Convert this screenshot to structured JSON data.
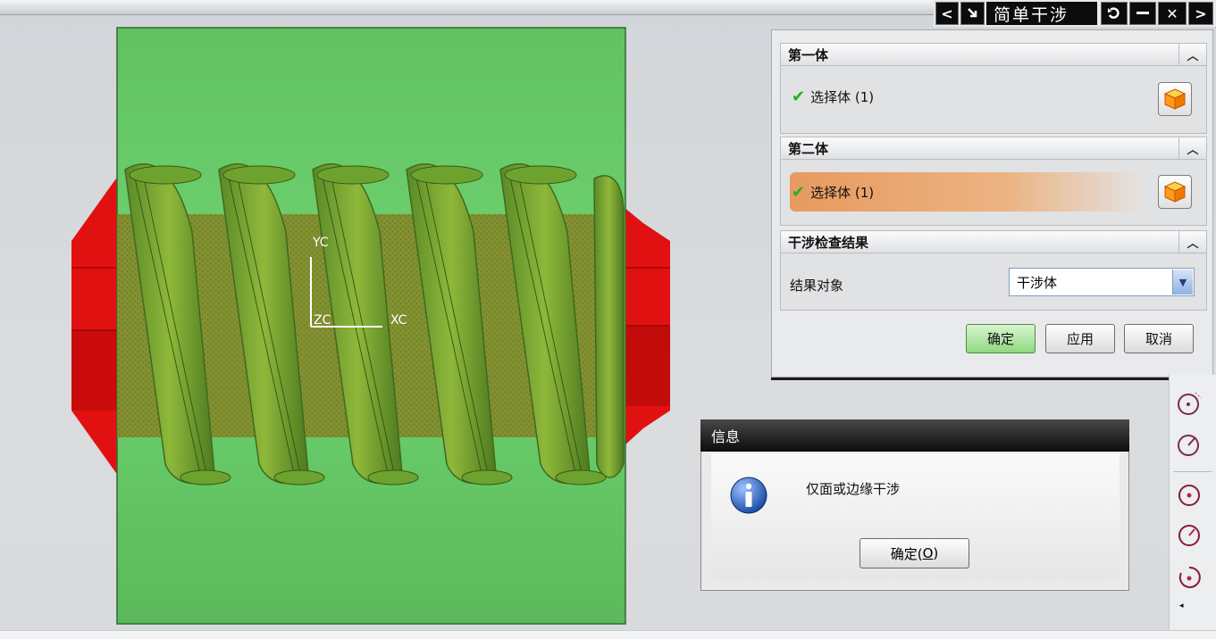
{
  "title_bar": {
    "title": "简单干涉",
    "prev_icon": "chevron-left-icon",
    "collapse_icon": "arrow-down-right-icon",
    "reset_icon": "reset-icon",
    "minimize_icon": "minimize-icon",
    "close_icon": "close-icon",
    "next_icon": "chevron-right-icon"
  },
  "dialog": {
    "section1": {
      "title": "第一体",
      "select_label": "选择体 (1)"
    },
    "section2": {
      "title": "第二体",
      "select_label": "选择体 (1)"
    },
    "section3": {
      "title": "干涉检查结果",
      "field_label": "结果对象",
      "field_value": "干涉体"
    },
    "buttons": {
      "ok": "确定",
      "apply": "应用",
      "cancel": "取消"
    }
  },
  "info_dialog": {
    "title": "信息",
    "message": "仅面或边缘干涉",
    "ok_prefix": "确定(",
    "ok_mnemonic": "O",
    "ok_suffix": ")"
  },
  "viewport": {
    "axis_y": "YC",
    "axis_x": "XC",
    "axis_z": "ZC"
  },
  "colors": {
    "green_body": "#5ec45e",
    "red_body": "#e01010",
    "highlight_row": "#e8a46a",
    "dialog_bg": "#e9eaec"
  }
}
